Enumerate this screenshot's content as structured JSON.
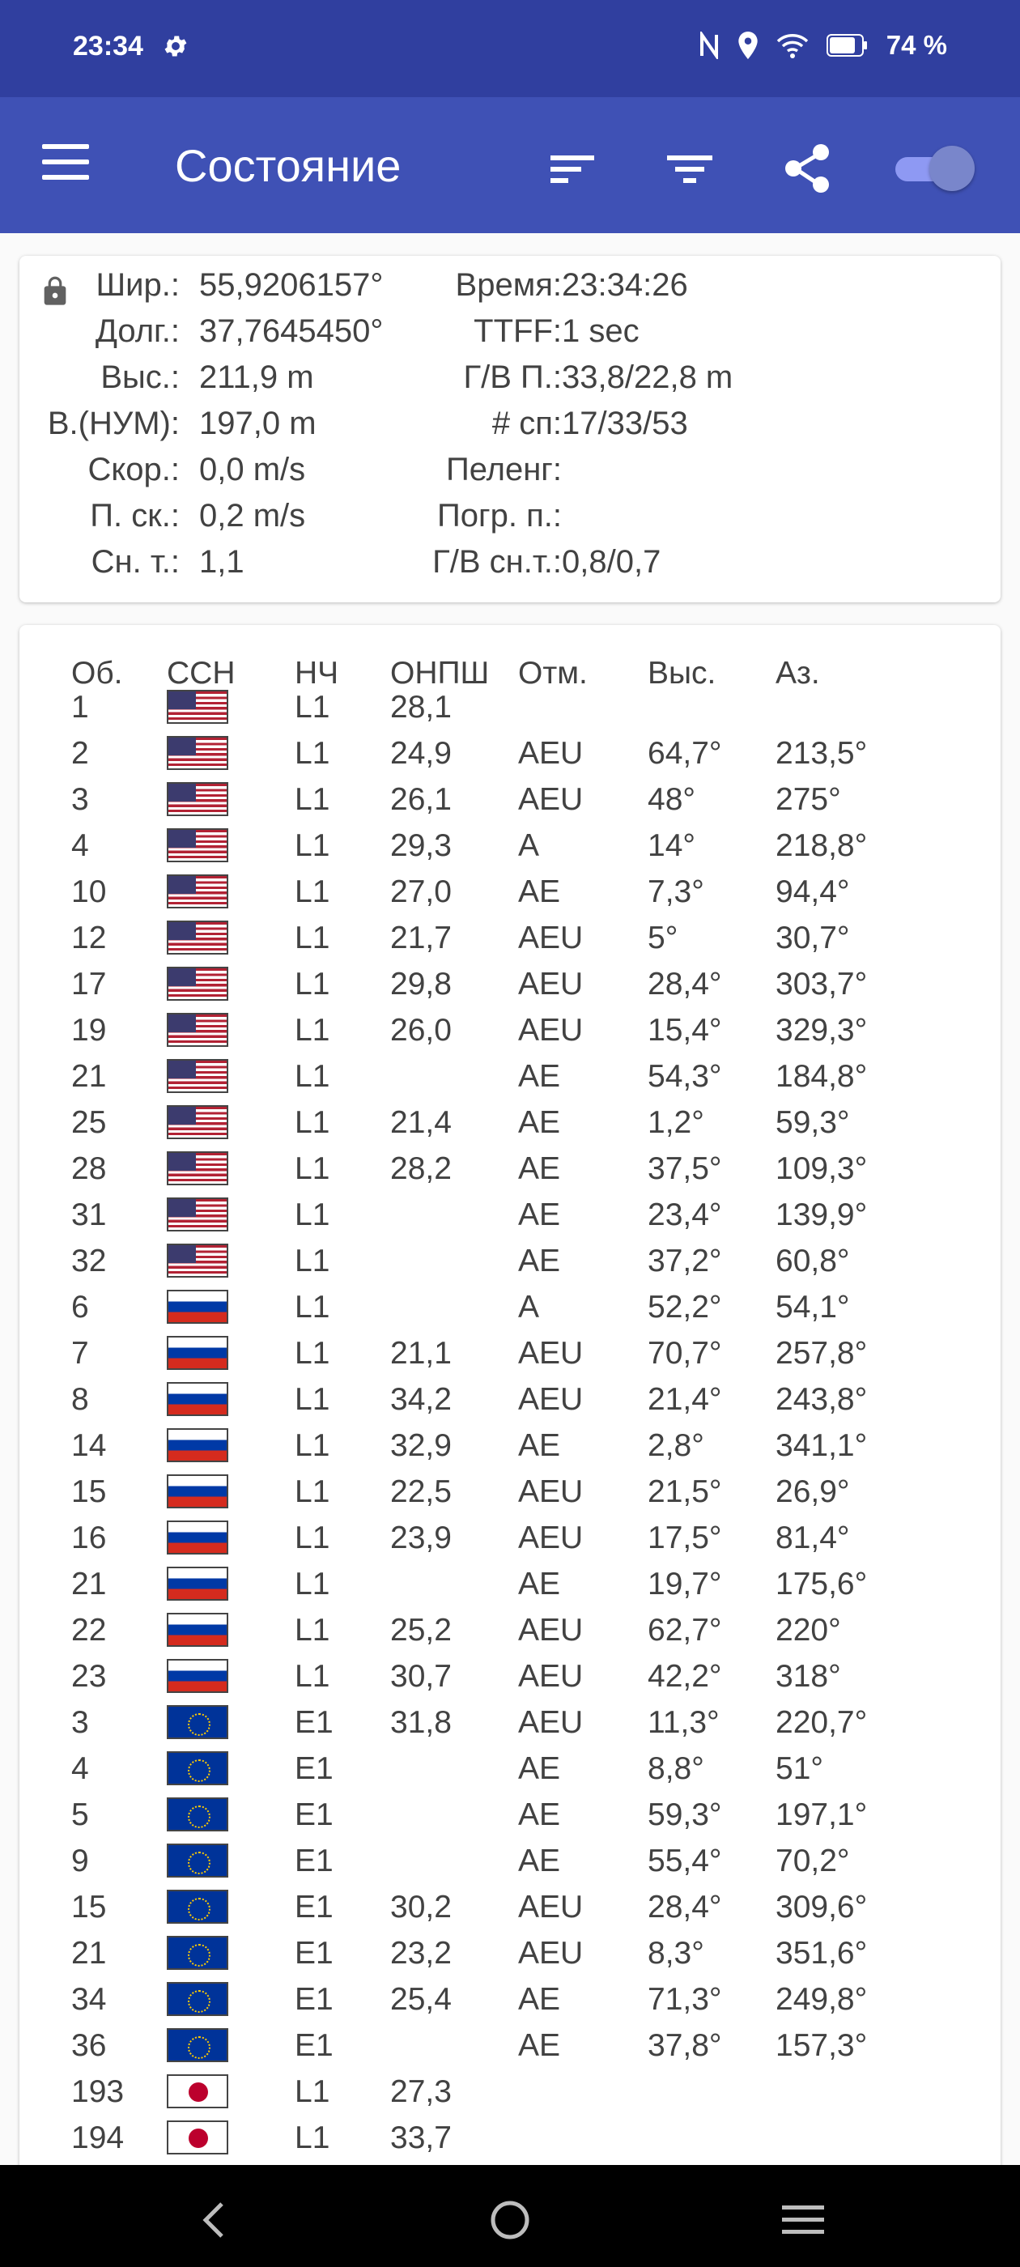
{
  "status_bar": {
    "time": "23:34",
    "battery": "74 %"
  },
  "toolbar": {
    "title": "Состояние"
  },
  "info": {
    "left": [
      {
        "label": "Шир.:",
        "value": "55,9206157°"
      },
      {
        "label": "Долг.:",
        "value": "37,7645450°"
      },
      {
        "label": "Выс.:",
        "value": "211,9 m"
      },
      {
        "label": "В.(НУМ):",
        "value": "197,0 m"
      },
      {
        "label": "Скор.:",
        "value": "0,0 m/s"
      },
      {
        "label": "П. ск.:",
        "value": "0,2 m/s"
      },
      {
        "label": "Сн. т.:",
        "value": "1,1"
      }
    ],
    "right": [
      {
        "label": "Время:",
        "value": "23:34:26"
      },
      {
        "label": "TTFF:",
        "value": "1 sec"
      },
      {
        "label": "Г/В П.:",
        "value": "33,8/22,8 m"
      },
      {
        "label": "# сп:",
        "value": "17/33/53"
      },
      {
        "label": "Пеленг:",
        "value": ""
      },
      {
        "label": "Погр. п.:",
        "value": ""
      },
      {
        "label": "Г/В сн.т.:",
        "value": "0,8/0,7"
      }
    ]
  },
  "table": {
    "headers": [
      "Об.",
      "ССН",
      "НЧ",
      "ОНПШ",
      "Отм.",
      "Выс.",
      "Аз."
    ],
    "rows": [
      {
        "id": "1",
        "flag": "us",
        "band": "L1",
        "cn0": "28,1",
        "flags": "",
        "elev": "",
        "azim": ""
      },
      {
        "id": "2",
        "flag": "us",
        "band": "L1",
        "cn0": "24,9",
        "flags": "AEU",
        "elev": "64,7°",
        "azim": "213,5°"
      },
      {
        "id": "3",
        "flag": "us",
        "band": "L1",
        "cn0": "26,1",
        "flags": "AEU",
        "elev": "48°",
        "azim": "275°"
      },
      {
        "id": "4",
        "flag": "us",
        "band": "L1",
        "cn0": "29,3",
        "flags": "A",
        "elev": "14°",
        "azim": "218,8°"
      },
      {
        "id": "10",
        "flag": "us",
        "band": "L1",
        "cn0": "27,0",
        "flags": "AE",
        "elev": "7,3°",
        "azim": "94,4°"
      },
      {
        "id": "12",
        "flag": "us",
        "band": "L1",
        "cn0": "21,7",
        "flags": "AEU",
        "elev": "5°",
        "azim": "30,7°"
      },
      {
        "id": "17",
        "flag": "us",
        "band": "L1",
        "cn0": "29,8",
        "flags": "AEU",
        "elev": "28,4°",
        "azim": "303,7°"
      },
      {
        "id": "19",
        "flag": "us",
        "band": "L1",
        "cn0": "26,0",
        "flags": "AEU",
        "elev": "15,4°",
        "azim": "329,3°"
      },
      {
        "id": "21",
        "flag": "us",
        "band": "L1",
        "cn0": "",
        "flags": "AE",
        "elev": "54,3°",
        "azim": "184,8°"
      },
      {
        "id": "25",
        "flag": "us",
        "band": "L1",
        "cn0": "21,4",
        "flags": "AE",
        "elev": "1,2°",
        "azim": "59,3°"
      },
      {
        "id": "28",
        "flag": "us",
        "band": "L1",
        "cn0": "28,2",
        "flags": "AE",
        "elev": "37,5°",
        "azim": "109,3°"
      },
      {
        "id": "31",
        "flag": "us",
        "band": "L1",
        "cn0": "",
        "flags": "AE",
        "elev": "23,4°",
        "azim": "139,9°"
      },
      {
        "id": "32",
        "flag": "us",
        "band": "L1",
        "cn0": "",
        "flags": "AE",
        "elev": "37,2°",
        "azim": "60,8°"
      },
      {
        "id": "6",
        "flag": "ru",
        "band": "L1",
        "cn0": "",
        "flags": "A",
        "elev": "52,2°",
        "azim": "54,1°"
      },
      {
        "id": "7",
        "flag": "ru",
        "band": "L1",
        "cn0": "21,1",
        "flags": "AEU",
        "elev": "70,7°",
        "azim": "257,8°"
      },
      {
        "id": "8",
        "flag": "ru",
        "band": "L1",
        "cn0": "34,2",
        "flags": "AEU",
        "elev": "21,4°",
        "azim": "243,8°"
      },
      {
        "id": "14",
        "flag": "ru",
        "band": "L1",
        "cn0": "32,9",
        "flags": "AE",
        "elev": "2,8°",
        "azim": "341,1°"
      },
      {
        "id": "15",
        "flag": "ru",
        "band": "L1",
        "cn0": "22,5",
        "flags": "AEU",
        "elev": "21,5°",
        "azim": "26,9°"
      },
      {
        "id": "16",
        "flag": "ru",
        "band": "L1",
        "cn0": "23,9",
        "flags": "AEU",
        "elev": "17,5°",
        "azim": "81,4°"
      },
      {
        "id": "21",
        "flag": "ru",
        "band": "L1",
        "cn0": "",
        "flags": "AE",
        "elev": "19,7°",
        "azim": "175,6°"
      },
      {
        "id": "22",
        "flag": "ru",
        "band": "L1",
        "cn0": "25,2",
        "flags": "AEU",
        "elev": "62,7°",
        "azim": "220°"
      },
      {
        "id": "23",
        "flag": "ru",
        "band": "L1",
        "cn0": "30,7",
        "flags": "AEU",
        "elev": "42,2°",
        "azim": "318°"
      },
      {
        "id": "3",
        "flag": "eu",
        "band": "E1",
        "cn0": "31,8",
        "flags": "AEU",
        "elev": "11,3°",
        "azim": "220,7°"
      },
      {
        "id": "4",
        "flag": "eu",
        "band": "E1",
        "cn0": "",
        "flags": "AE",
        "elev": "8,8°",
        "azim": "51°"
      },
      {
        "id": "5",
        "flag": "eu",
        "band": "E1",
        "cn0": "",
        "flags": "AE",
        "elev": "59,3°",
        "azim": "197,1°"
      },
      {
        "id": "9",
        "flag": "eu",
        "band": "E1",
        "cn0": "",
        "flags": "AE",
        "elev": "55,4°",
        "azim": "70,2°"
      },
      {
        "id": "15",
        "flag": "eu",
        "band": "E1",
        "cn0": "30,2",
        "flags": "AEU",
        "elev": "28,4°",
        "azim": "309,6°"
      },
      {
        "id": "21",
        "flag": "eu",
        "band": "E1",
        "cn0": "23,2",
        "flags": "AEU",
        "elev": "8,3°",
        "azim": "351,6°"
      },
      {
        "id": "34",
        "flag": "eu",
        "band": "E1",
        "cn0": "25,4",
        "flags": "AE",
        "elev": "71,3°",
        "azim": "249,8°"
      },
      {
        "id": "36",
        "flag": "eu",
        "band": "E1",
        "cn0": "",
        "flags": "AE",
        "elev": "37,8°",
        "azim": "157,3°"
      },
      {
        "id": "193",
        "flag": "jp",
        "band": "L1",
        "cn0": "27,3",
        "flags": "",
        "elev": "",
        "azim": ""
      },
      {
        "id": "194",
        "flag": "jp",
        "band": "L1",
        "cn0": "33,7",
        "flags": "",
        "elev": "",
        "azim": ""
      }
    ]
  }
}
